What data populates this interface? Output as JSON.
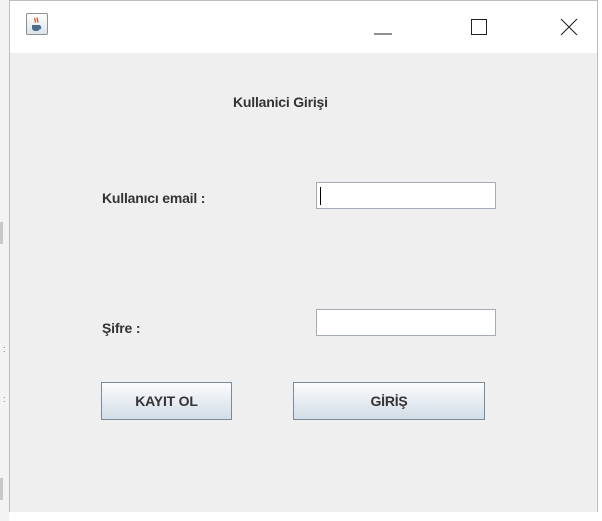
{
  "window": {
    "icon": "java-cup-icon",
    "controls": {
      "minimize": "minimize-icon",
      "maximize": "maximize-icon",
      "close": "close-icon"
    }
  },
  "form": {
    "title": "Kullanici Girişi",
    "email_label": "Kullanıcı email :",
    "email_value": "",
    "password_label": "Şifre :",
    "password_value": ""
  },
  "buttons": {
    "register": "KAYIT OL",
    "login": "GİRİŞ"
  },
  "colors": {
    "content_bg": "#efefef",
    "titlebar_bg": "#ffffff",
    "button_border": "#7a8a99"
  }
}
